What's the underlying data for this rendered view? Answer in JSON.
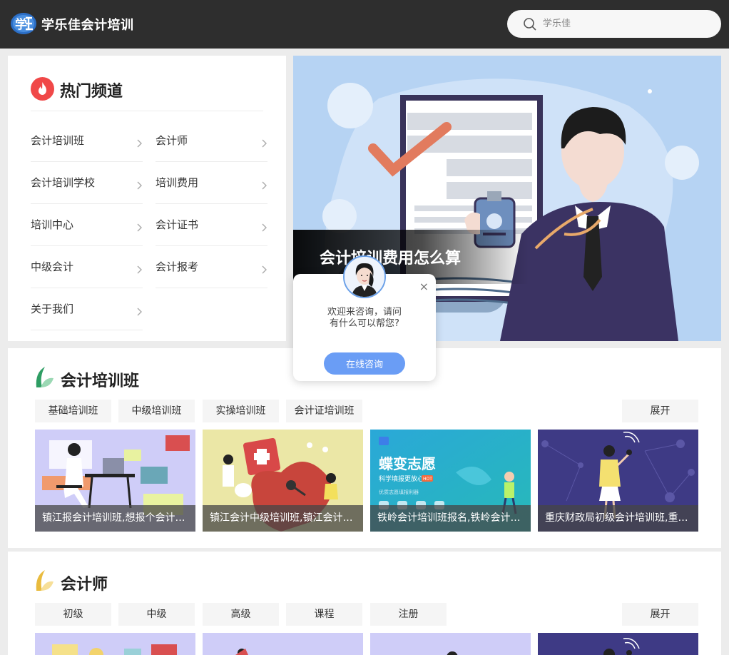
{
  "header": {
    "logo_text": "学",
    "site_name": "学乐佳会计培训",
    "search_placeholder": "学乐佳"
  },
  "hot": {
    "title": "热门频道",
    "channels": [
      {
        "label": "会计培训班"
      },
      {
        "label": "会计师"
      },
      {
        "label": "会计培训学校"
      },
      {
        "label": "培训费用"
      },
      {
        "label": "培训中心"
      },
      {
        "label": "会计证书"
      },
      {
        "label": "中级会计"
      },
      {
        "label": "会计报考"
      },
      {
        "label": "关于我们"
      }
    ]
  },
  "banner": {
    "caption": "会计培训费用怎么算"
  },
  "chat": {
    "close": "×",
    "message": "欢迎来咨询，请问有什么可以帮您?",
    "button": "在线咨询"
  },
  "sections": [
    {
      "title": "会计培训班",
      "tags": [
        "基础培训班",
        "中级培训班",
        "实操培训班",
        "会计证培训班"
      ],
      "expand": "展开",
      "cards": [
        {
          "caption": "镇江报会计培训班,想报个会计培训班"
        },
        {
          "caption": "镇江会计中级培训班,镇江会计考试培训"
        },
        {
          "caption": "铁岭会计培训班报名,铁岭会计培训学校"
        },
        {
          "caption": "重庆财政局初级会计培训班,重庆会计"
        }
      ],
      "card3_title": "蝶变志愿",
      "card3_sub": "科学填报更放心",
      "card3_badge": "HOT",
      "card3_small": "优质志愿填报利器"
    },
    {
      "title": "会计师",
      "tags": [
        "初级",
        "中级",
        "高级",
        "课程",
        "注册"
      ],
      "expand": "展开"
    }
  ],
  "colors": {
    "header_bg": "#2e2e2e",
    "accent_blue": "#6a9df5",
    "fire_red": "#f04848"
  }
}
